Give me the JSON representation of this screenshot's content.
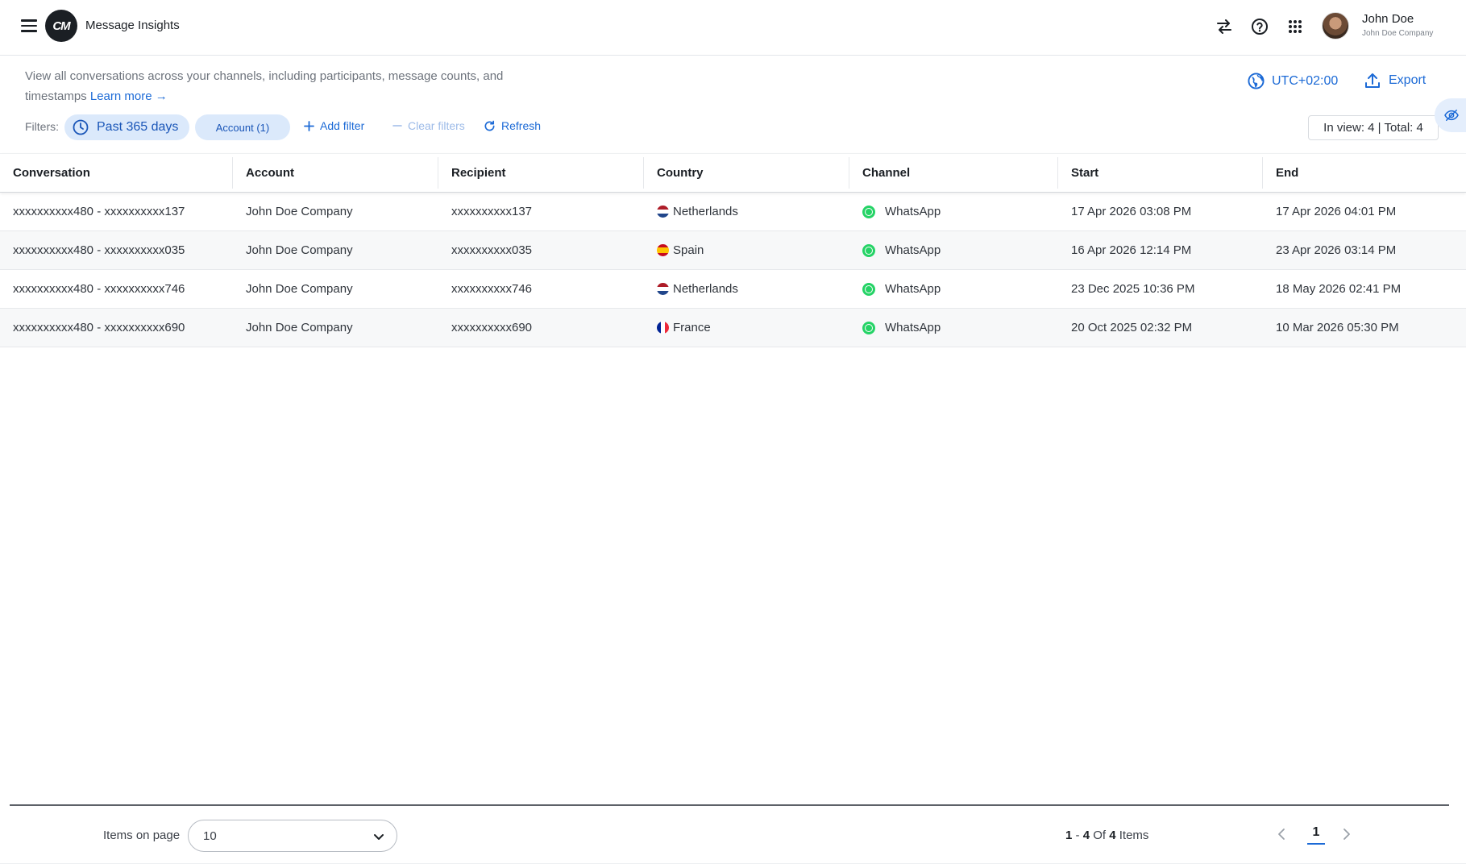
{
  "header": {
    "logo_text": "CM",
    "app_title": "Message Insights",
    "user": {
      "name": "John Doe",
      "company": "John Doe Company"
    }
  },
  "intro": {
    "description": "View all conversations across your channels, including participants, message counts, and timestamps",
    "learn_more": "Learn more →"
  },
  "toolbar": {
    "timezone": "UTC+02:00",
    "export": "Export"
  },
  "filters": {
    "label": "Filters:",
    "date_chip": "Past 365 days",
    "account_chip": "Account (1)",
    "add_filter": "Add filter",
    "clear_filters": "Clear filters",
    "refresh": "Refresh",
    "in_view": "In view: 4  |  Total: 4"
  },
  "table": {
    "columns": [
      "Conversation",
      "Account",
      "Recipient",
      "Country",
      "Channel",
      "Start",
      "End"
    ],
    "rows": [
      {
        "conversation": "xxxxxxxxxx480 - xxxxxxxxxx137",
        "account": "John Doe Company",
        "recipient": "xxxxxxxxxx137",
        "country": "Netherlands",
        "channel": "WhatsApp",
        "start": "17 Apr 2026 03:08 PM",
        "end": "17 Apr 2026 04:01 PM"
      },
      {
        "conversation": "xxxxxxxxxx480 - xxxxxxxxxx035",
        "account": "John Doe Company",
        "recipient": "xxxxxxxxxx035",
        "country": "Spain",
        "channel": "WhatsApp",
        "start": "16 Apr 2026 12:14 PM",
        "end": "23 Apr 2026 03:14 PM"
      },
      {
        "conversation": "xxxxxxxxxx480 - xxxxxxxxxx746",
        "account": "John Doe Company",
        "recipient": "xxxxxxxxxx746",
        "country": "Netherlands",
        "channel": "WhatsApp",
        "start": "23 Dec 2025 10:36 PM",
        "end": "18 May 2026 02:41 PM"
      },
      {
        "conversation": "xxxxxxxxxx480 - xxxxxxxxxx690",
        "account": "John Doe Company",
        "recipient": "xxxxxxxxxx690",
        "country": "France",
        "channel": "WhatsApp",
        "start": "20 Oct 2025 02:32 PM",
        "end": "10 Mar 2026 05:30 PM"
      }
    ]
  },
  "footer": {
    "items_label": "Items on page",
    "page_size": "10",
    "range_from": "1",
    "range_to": "4",
    "range_of": "Of",
    "range_total": "4",
    "range_items": "Items",
    "current_page": "1"
  },
  "icons": {
    "menu": "hamburger-icon",
    "swap": "swap-arrows-icon",
    "help": "question-circle-icon",
    "apps": "apps-grid-icon",
    "timezone": "globe-icon",
    "export": "upload-icon",
    "date": "clock-icon",
    "add": "plus-icon",
    "clear": "minus-icon",
    "refresh": "refresh-icon",
    "hide": "eye-off-icon",
    "whatsapp": "whatsapp-icon"
  },
  "colors": {
    "accent": "#1c6ad6",
    "chip_bg": "#dbe9fb",
    "whatsapp": "#25d366"
  }
}
